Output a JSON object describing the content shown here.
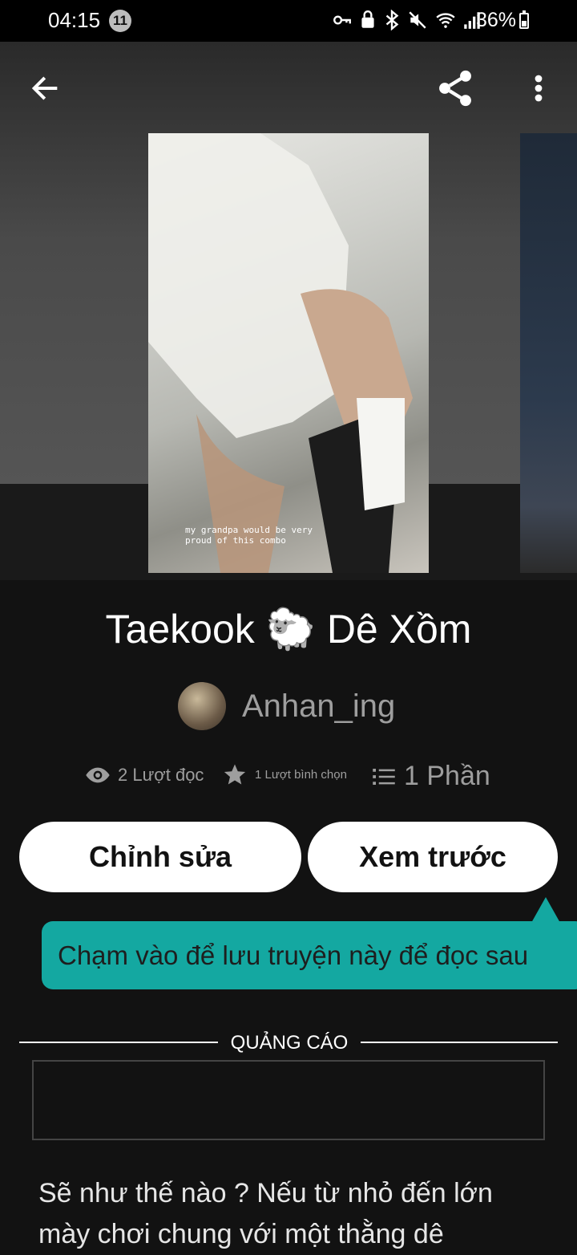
{
  "status_bar": {
    "time": "04:15",
    "notification_count": "11",
    "battery_text": "36%"
  },
  "cover": {
    "caption": "my grandpa would be very\nproud of this combo"
  },
  "story": {
    "title": "Taekook 🐑 Dê Xồm",
    "author": "Anhan_ing",
    "reads": "2 Lượt đọc",
    "votes": "1 Lượt bình chọn",
    "parts": "1 Phần"
  },
  "actions": {
    "edit_label": "Chỉnh sửa",
    "preview_label": "Xem trước"
  },
  "tooltip": {
    "text": "Chạm vào để lưu truyện này để đọc sau"
  },
  "ad": {
    "label": "QUẢNG CÁO"
  },
  "description": "Sẽ như thế nào ? Nếu từ nhỏ đến lớn mày chơi chung với một thằng dê",
  "icons": {
    "back": "arrow-left-icon",
    "share": "share-icon",
    "more": "more-vertical-icon",
    "reads": "eye-icon",
    "votes": "star-icon",
    "parts": "list-icon"
  },
  "colors": {
    "background": "#121212",
    "tooltip": "#14a8a1",
    "button": "#ffffff",
    "muted_text": "#9e9e9e"
  }
}
